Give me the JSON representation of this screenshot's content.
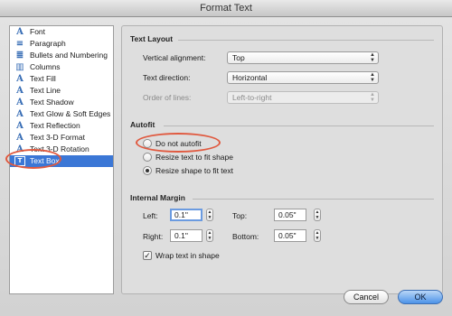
{
  "window": {
    "title": "Format Text"
  },
  "sidebar": {
    "items": [
      {
        "label": "Font",
        "icon": "font-icon",
        "glyph": "A"
      },
      {
        "label": "Paragraph",
        "icon": "paragraph-icon",
        "glyph": "≡"
      },
      {
        "label": "Bullets and Numbering",
        "icon": "bullets-icon",
        "glyph": "≣"
      },
      {
        "label": "Columns",
        "icon": "columns-icon",
        "glyph": "▥"
      },
      {
        "label": "Text Fill",
        "icon": "text-fill-icon",
        "glyph": "A"
      },
      {
        "label": "Text Line",
        "icon": "text-line-icon",
        "glyph": "A"
      },
      {
        "label": "Text Shadow",
        "icon": "text-shadow-icon",
        "glyph": "A"
      },
      {
        "label": "Text Glow & Soft Edges",
        "icon": "text-glow-icon",
        "glyph": "A"
      },
      {
        "label": "Text Reflection",
        "icon": "text-reflection-icon",
        "glyph": "A"
      },
      {
        "label": "Text 3-D Format",
        "icon": "text-3d-format-icon",
        "glyph": "A"
      },
      {
        "label": "Text 3-D Rotation",
        "icon": "text-3d-rotation-icon",
        "glyph": "A"
      },
      {
        "label": "Text Box",
        "icon": "text-box-icon",
        "glyph": "T"
      }
    ],
    "selected": "Text Box"
  },
  "text_layout": {
    "heading": "Text Layout",
    "vertical_alignment_label": "Vertical alignment:",
    "vertical_alignment_value": "Top",
    "text_direction_label": "Text direction:",
    "text_direction_value": "Horizontal",
    "order_of_lines_label": "Order of lines:",
    "order_of_lines_value": "Left-to-right"
  },
  "autofit": {
    "heading": "Autofit",
    "options": [
      "Do not autofit",
      "Resize text to fit shape",
      "Resize shape to fit text"
    ],
    "selected": "Resize shape to fit text"
  },
  "internal_margin": {
    "heading": "Internal Margin",
    "left_label": "Left:",
    "left_value": "0.1\"",
    "top_label": "Top:",
    "top_value": "0.05\"",
    "right_label": "Right:",
    "right_value": "0.1\"",
    "bottom_label": "Bottom:",
    "bottom_value": "0.05\"",
    "wrap_label": "Wrap text in shape",
    "wrap_checked": true
  },
  "buttons": {
    "cancel": "Cancel",
    "ok": "OK"
  },
  "colors": {
    "selection": "#3b77d6",
    "callout": "#e0593f",
    "default_button": "#4c93e8"
  }
}
